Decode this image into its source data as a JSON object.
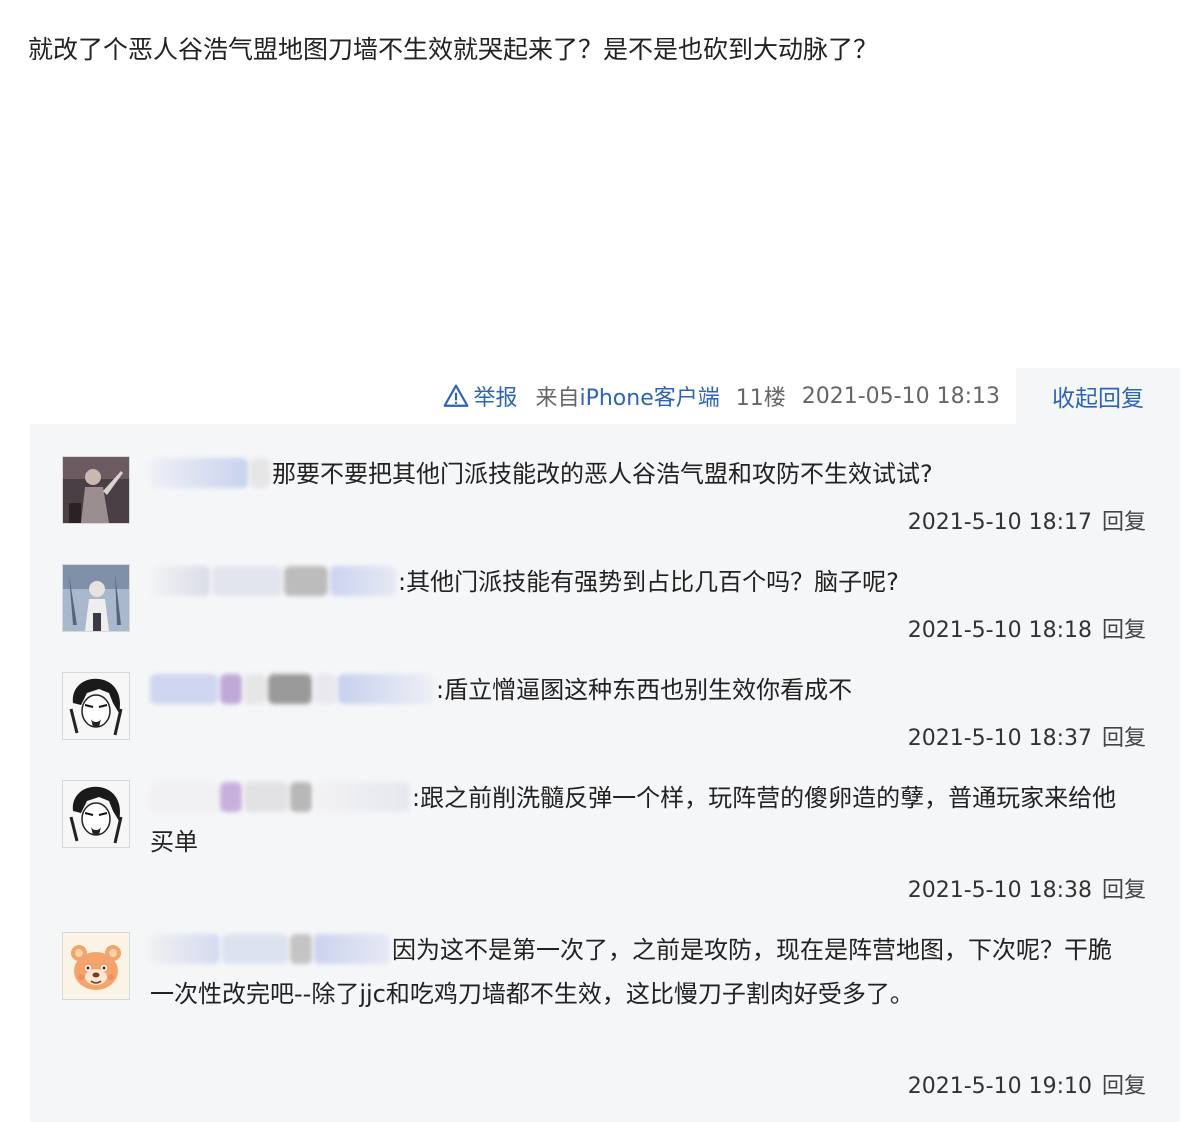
{
  "post": {
    "text": "就改了个恶人谷浩气盟地图刀墙不生效就哭起来了？是不是也砍到大动脉了？"
  },
  "meta": {
    "report_label": "举报",
    "source_prefix": "来自",
    "source_brand": "iPhone",
    "source_suffix": "客户端",
    "floor": "11楼",
    "datetime": "2021-05-10 18:13",
    "collapse_label": "收起回复"
  },
  "colors": {
    "link": "#2d64b3",
    "reply_bg": "#f5f6f8"
  },
  "replies": [
    {
      "avatar_icon": "game-character-avatar-dark-icon",
      "text": "那要不要把其他门派技能改的恶人谷浩气盟和攻防不生效试试?",
      "time": "2021-5-10 18:17",
      "reply_label": "回复"
    },
    {
      "avatar_icon": "game-character-avatar-light-icon",
      "text": ":其他门派技能有强势到占比几百个吗？脑子呢?",
      "time": "2021-5-10 18:18",
      "reply_label": "回复"
    },
    {
      "avatar_icon": "anime-sketch-avatar-icon",
      "text": ":盾立憎逼圂这种东西也别生效你看成不",
      "time": "2021-5-10 18:37",
      "reply_label": "回复"
    },
    {
      "avatar_icon": "anime-sketch-avatar-icon",
      "text": ":跟之前削洗髓反弹一个样，玩阵营的傻卵造的孽，普通玩家来给他买单",
      "time": "2021-5-10 18:38",
      "reply_label": "回复"
    },
    {
      "avatar_icon": "bear-face-avatar-icon",
      "text": "因为这不是第一次了，之前是攻防，现在是阵营地图，下次呢？干脆一次性改完吧--除了jjc和吃鸡刀墙都不生效，这比慢刀子割肉好受多了。",
      "time": "2021-5-10 19:10",
      "reply_label": "回复"
    }
  ]
}
